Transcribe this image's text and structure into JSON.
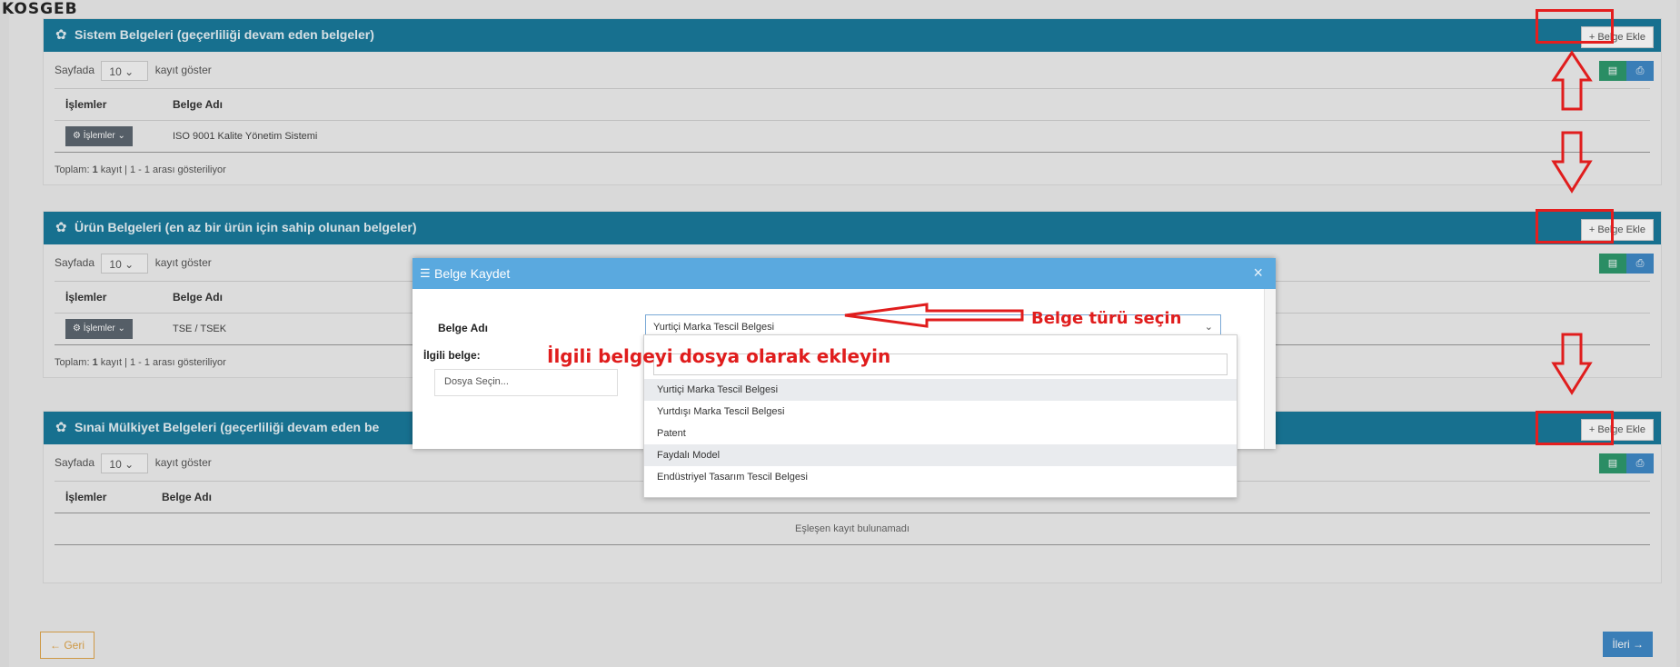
{
  "brand": "KOSGEB",
  "panels": [
    {
      "title": "Sistem Belgeleri (geçerliliği devam eden belgeler)",
      "add_button": "+ Belge Ekle",
      "page_size_prefix": "Sayfada",
      "page_size": "10",
      "page_size_suffix": "kayıt göster",
      "col_actions": "İşlemler",
      "col_name": "Belge Adı",
      "row_action": "İşlemler",
      "row_name": "ISO 9001 Kalite Yönetim Sistemi",
      "summary_prefix": "Toplam:",
      "summary_count": "1",
      "summary_suffix": "kayıt | 1 - 1 arası gösteriliyor"
    },
    {
      "title": "Ürün Belgeleri (en az bir ürün için sahip olunan belgeler)",
      "add_button": "+ Belge Ekle",
      "page_size_prefix": "Sayfada",
      "page_size": "10",
      "page_size_suffix": "kayıt göster",
      "col_actions": "İşlemler",
      "col_name": "Belge Adı",
      "row_action": "İşlemler",
      "row_name": "TSE / TSEK",
      "summary_prefix": "Toplam:",
      "summary_count": "1",
      "summary_suffix": "kayıt | 1 - 1 arası gösteriliyor"
    },
    {
      "title": "Sınai Mülkiyet Belgeleri (geçerliliği devam eden be",
      "add_button": "+ Belge Ekle",
      "page_size_prefix": "Sayfada",
      "page_size": "10",
      "page_size_suffix": "kayıt göster",
      "col_actions": "İşlemler",
      "col_name": "Belge Adı",
      "empty_text": "Eşleşen kayıt bulunamadı"
    }
  ],
  "nav": {
    "back": "← Geri",
    "next": "İleri →"
  },
  "modal": {
    "title": "Belge Kaydet",
    "close": "×",
    "field_name_label": "Belge Adı",
    "selected_value": "Yurtiçi Marka Tescil Belgesi",
    "related_label": "İlgili belge:",
    "file_placeholder": "Dosya Seçin...",
    "options": [
      "Yurtiçi Marka Tescil Belgesi",
      "Yurtdışı Marka Tescil Belgesi",
      "Patent",
      "Faydalı Model",
      "Endüstriyel Tasarım Tescil Belgesi"
    ]
  },
  "annotations": {
    "choose_type": "Belge türü seçin",
    "attach_file": "İlgili belgeyi dosya olarak ekleyin"
  },
  "colors": {
    "header": "#1a7a9c",
    "modal_header": "#5aa9df",
    "annotation": "#e01d1d",
    "primary": "#3f89c7",
    "success": "#2e9a6d"
  },
  "icons": [
    "cog-icon",
    "plus-icon",
    "excel-icon",
    "print-icon",
    "list-icon",
    "close-icon",
    "chevron-down-icon",
    "arrow-up-icon",
    "arrow-down-icon",
    "arrow-left-icon"
  ]
}
